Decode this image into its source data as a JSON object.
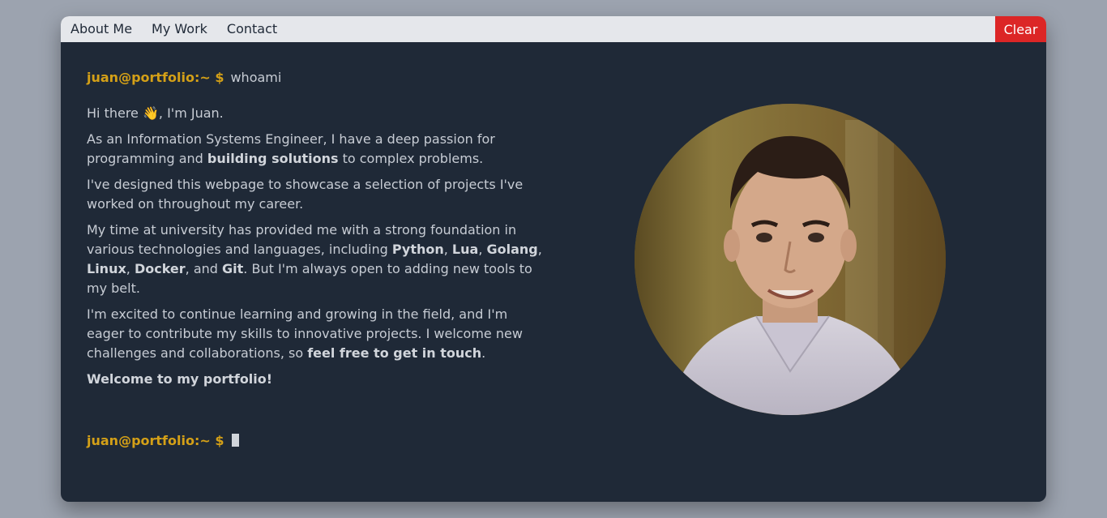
{
  "menu": {
    "items": [
      {
        "label": "About Me"
      },
      {
        "label": "My Work"
      },
      {
        "label": "Contact"
      }
    ],
    "clear_label": "Clear"
  },
  "terminal": {
    "prompt": "juan@portfolio:~ $",
    "command": "whoami",
    "paragraphs": {
      "p1": "Hi there 👋, I'm Juan.",
      "p2_a": "As an Information Systems Engineer, I have a deep passion for programming and ",
      "p2_b": "building solutions",
      "p2_c": " to complex problems.",
      "p3": "I've designed this webpage to showcase a selection of projects I've worked on throughout my career.",
      "p4_a": "My time at university has provided me with a strong foundation in various technologies and languages, including ",
      "p4_python": "Python",
      "p4_sep1": ", ",
      "p4_lua": "Lua",
      "p4_sep2": ", ",
      "p4_golang": "Golang",
      "p4_sep3": ", ",
      "p4_linux": "Linux",
      "p4_sep4": ", ",
      "p4_docker": "Docker",
      "p4_sep5": ", and ",
      "p4_git": "Git",
      "p4_c": ". But I'm always open to adding new tools to my belt.",
      "p5_a": "I'm excited to continue learning and growing in the field, and I'm eager to contribute my skills to innovative projects. I welcome new challenges and collaborations, so ",
      "p5_b": "feel free to get in touch",
      "p5_c": ".",
      "p6": "Welcome to my portfolio!"
    }
  },
  "colors": {
    "window_bg": "#1f2937",
    "menubar_bg": "#e5e7eb",
    "clear_bg": "#dc2626",
    "prompt": "#d4a017",
    "text": "#c7ccd4",
    "page_bg": "#9ca3af"
  }
}
